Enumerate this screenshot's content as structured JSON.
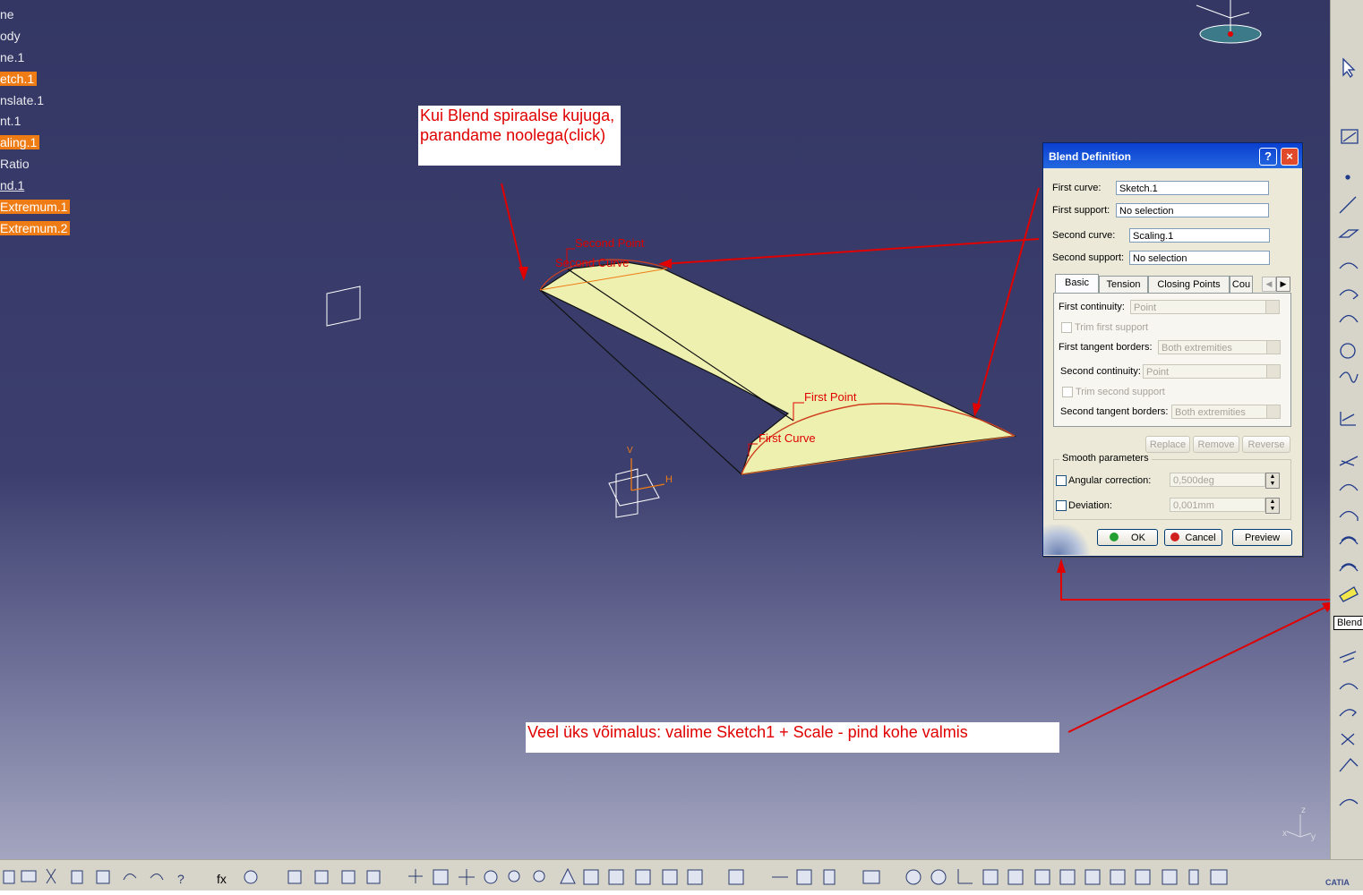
{
  "tree": {
    "items": [
      {
        "label": "ne",
        "selected": false,
        "underline": false
      },
      {
        "label": "ody",
        "selected": false,
        "underline": false
      },
      {
        "label": "ne.1",
        "selected": false,
        "underline": false
      },
      {
        "label": "etch.1",
        "selected": true,
        "underline": false
      },
      {
        "label": "nslate.1",
        "selected": false,
        "underline": false
      },
      {
        "label": "nt.1",
        "selected": false,
        "underline": false
      },
      {
        "label": "aling.1",
        "selected": true,
        "underline": false
      },
      {
        "label": "Ratio",
        "selected": false,
        "underline": false
      },
      {
        "label": "nd.1",
        "selected": false,
        "underline": true
      },
      {
        "label": "Extremum.1",
        "selected": true,
        "underline": false
      },
      {
        "label": "Extremum.2",
        "selected": true,
        "underline": false
      }
    ]
  },
  "notes": {
    "top_line1": "Kui Blend spiraalse kujuga,",
    "top_line2": "parandame noolega(click)",
    "bottom": "Veel üks võimalus: valime Sketch1 + Scale - pind kohe valmis"
  },
  "scene_labels": {
    "second_point": "Second Point",
    "second_curve": "Second Curve",
    "first_point": "First Point",
    "first_curve": "First Curve",
    "axis_v": "V",
    "axis_h": "H"
  },
  "tooltip": "Blend",
  "dialog": {
    "title": "Blend Definition",
    "help": "?",
    "close": "×",
    "first_curve_label": "First curve:",
    "first_curve_value": "Sketch.1",
    "first_support_label": "First support:",
    "first_support_value": "No selection",
    "second_curve_label": "Second curve:",
    "second_curve_value": "Scaling.1",
    "second_support_label": "Second support:",
    "second_support_value": "No selection",
    "tabs": [
      "Basic",
      "Tension",
      "Closing Points",
      "Cou"
    ],
    "first_continuity_label": "First continuity:",
    "first_continuity_value": "Point",
    "trim_first_label": "Trim first support",
    "first_tangent_label": "First tangent borders:",
    "first_tangent_value": "Both extremities",
    "second_continuity_label": "Second continuity:",
    "second_continuity_value": "Point",
    "trim_second_label": "Trim second support",
    "second_tangent_label": "Second tangent borders:",
    "second_tangent_value": "Both extremities",
    "replace": "Replace",
    "remove": "Remove",
    "reverse": "Reverse",
    "smooth_title": "Smooth parameters",
    "angular_label": "Angular correction:",
    "angular_value": "0,500deg",
    "deviation_label": "Deviation:",
    "deviation_value": "0,001mm",
    "ok": "OK",
    "cancel": "Cancel",
    "preview": "Preview"
  },
  "compass": {
    "x": "x",
    "y": "y",
    "z": "z"
  },
  "brand": "CATIA",
  "colors": {
    "annotation": "#e00000",
    "selection": "#ef7b14",
    "surface": "#eef0b0"
  }
}
